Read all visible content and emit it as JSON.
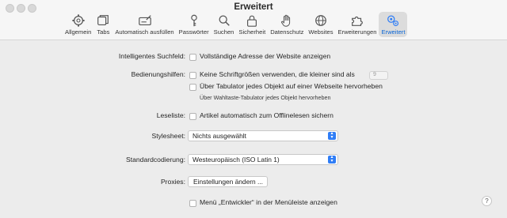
{
  "window": {
    "title": "Erweitert"
  },
  "tabs": [
    {
      "label": "Allgemein",
      "icon": "gear-icon"
    },
    {
      "label": "Tabs",
      "icon": "tabs-icon"
    },
    {
      "label": "Automatisch ausfüllen",
      "icon": "autofill-icon"
    },
    {
      "label": "Passwörter",
      "icon": "key-icon"
    },
    {
      "label": "Suchen",
      "icon": "search-icon"
    },
    {
      "label": "Sicherheit",
      "icon": "lock-icon"
    },
    {
      "label": "Datenschutz",
      "icon": "hand-icon"
    },
    {
      "label": "Websites",
      "icon": "globe-icon"
    },
    {
      "label": "Erweiterungen",
      "icon": "puzzle-icon"
    },
    {
      "label": "Erweitert",
      "icon": "gears-icon",
      "active": true
    }
  ],
  "settings": {
    "smart_search": {
      "label": "Intelligentes Suchfeld:",
      "option": "Vollständige Adresse der Website anzeigen"
    },
    "accessibility": {
      "label": "Bedienungshilfen:",
      "option1": "Keine Schriftgrößen verwenden, die kleiner sind als",
      "min_font_value": "9",
      "option2": "Über Tabulator jedes Objekt auf einer Webseite hervorheben",
      "hint": "Über Wahltaste-Tabulator jedes Objekt hervorheben"
    },
    "reading_list": {
      "label": "Leseliste:",
      "option": "Artikel automatisch zum Offlinelesen sichern"
    },
    "stylesheet": {
      "label": "Stylesheet:",
      "value": "Nichts ausgewählt"
    },
    "encoding": {
      "label": "Standardcodierung:",
      "value": "Westeuropäisch (ISO Latin 1)"
    },
    "proxies": {
      "label": "Proxies:",
      "button": "Einstellungen ändern ..."
    },
    "developer": {
      "option": "Menü „Entwickler“ in der Menüleiste anzeigen"
    }
  },
  "help": {
    "label": "?"
  },
  "colors": {
    "accent": "#2f7df6",
    "active_tab_text": "#0a66d6"
  }
}
